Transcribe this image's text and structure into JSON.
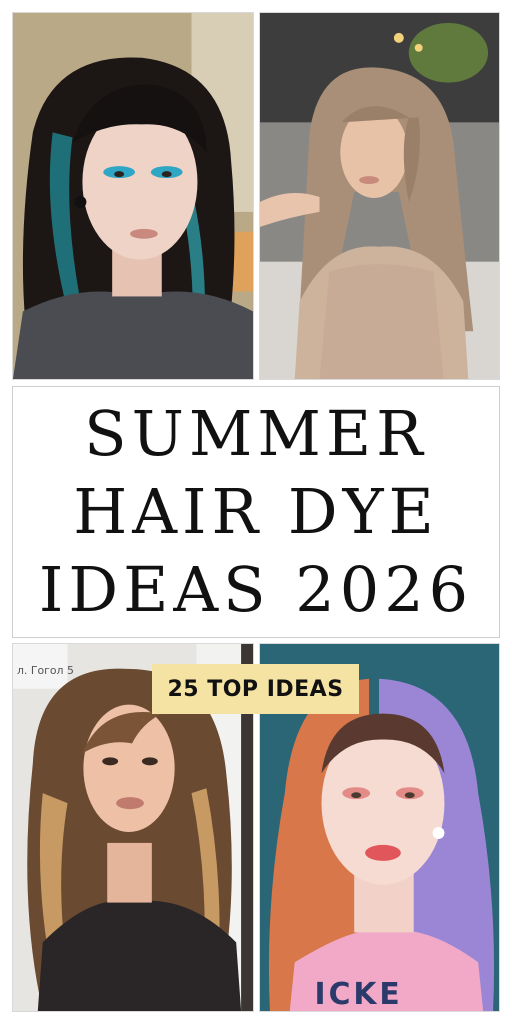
{
  "title": {
    "line1": "SUMMER",
    "line2": "HAIR DYE",
    "line3": "IDEAS 2026"
  },
  "badge": {
    "label": "25 TOP IDEAS",
    "color": "#f5e3a3"
  },
  "photos": [
    {
      "name": "dark-hair-teal-streaks-photo"
    },
    {
      "name": "ash-blonde-waves-photo"
    },
    {
      "name": "caramel-balayage-photo"
    },
    {
      "name": "copper-purple-split-photo"
    }
  ],
  "background_text": "л. Гогол 5"
}
